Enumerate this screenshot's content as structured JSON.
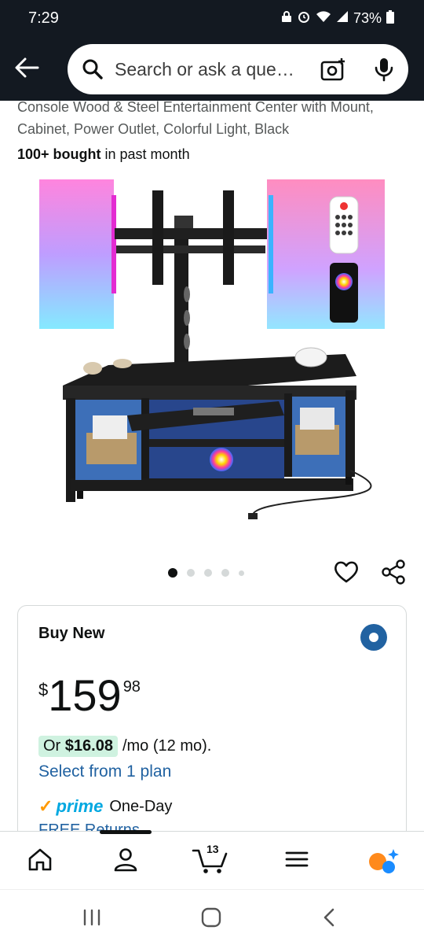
{
  "status": {
    "time": "7:29",
    "battery": "73%"
  },
  "search": {
    "placeholder": "Search or ask a que…"
  },
  "product": {
    "title": "Console Wood & Steel Entertainment Center with Mount, Cabinet, Power Outlet, Colorful Light, Black",
    "bought_bold": "100+ bought",
    "bought_rest": " in past month",
    "image_count": 5,
    "active_image": 1
  },
  "buybox": {
    "label": "Buy New",
    "currency": "$",
    "price_whole": "159",
    "price_fraction": "98",
    "monthly_prefix": "Or",
    "monthly_amount": "$16.08",
    "monthly_rest": "/mo (12 mo).",
    "plan_link": "Select from 1 plan",
    "prime_check": "✓",
    "prime_word": "prime",
    "prime_speed": "One-Day",
    "returns": "FREE Returns"
  },
  "nav": {
    "cart_count": "13"
  },
  "colors": {
    "header_bg": "#131921",
    "link": "#2162a1",
    "prime": "#00a8e1",
    "accent": "#ff9900",
    "monthly_bg": "#cff2e0"
  }
}
